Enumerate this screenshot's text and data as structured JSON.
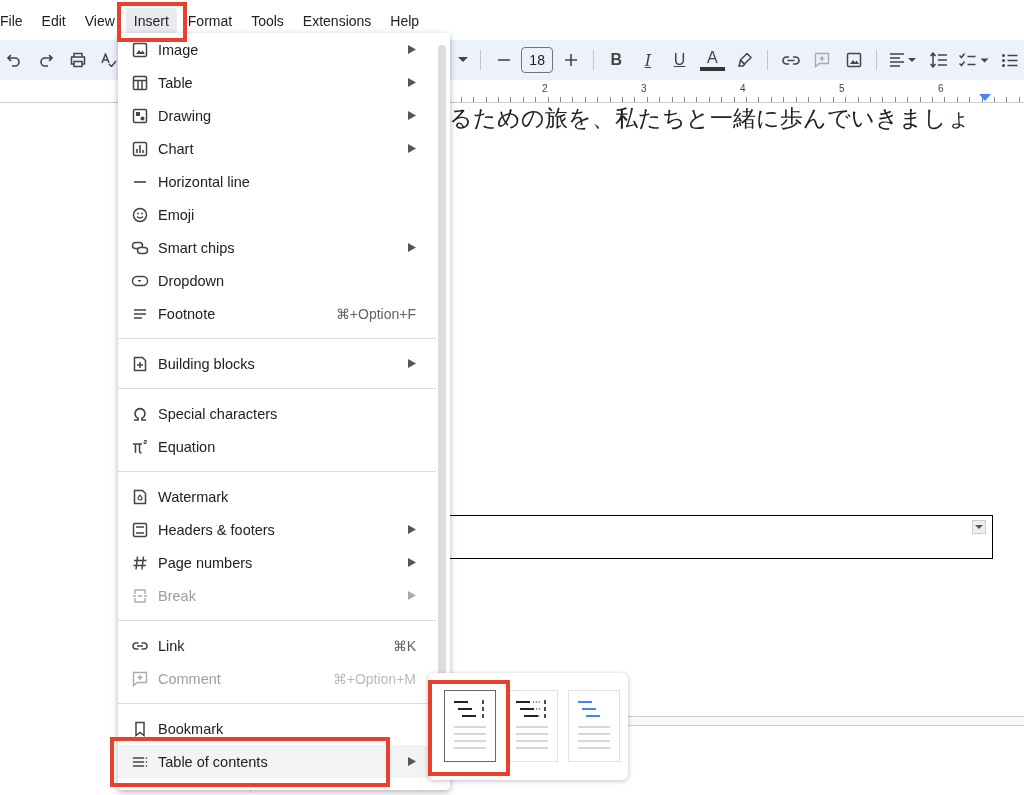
{
  "menu_bar": [
    {
      "label": "File",
      "selected": false,
      "highlighted": false
    },
    {
      "label": "Edit",
      "selected": false,
      "highlighted": false
    },
    {
      "label": "View",
      "selected": false,
      "highlighted": false
    },
    {
      "label": "Insert",
      "selected": true,
      "highlighted": true
    },
    {
      "label": "Format",
      "selected": false,
      "highlighted": false
    },
    {
      "label": "Tools",
      "selected": false,
      "highlighted": false
    },
    {
      "label": "Extensions",
      "selected": false,
      "highlighted": false
    },
    {
      "label": "Help",
      "selected": false,
      "highlighted": false
    }
  ],
  "toolbar": {
    "font_size": "18",
    "format_buttons": [
      "B",
      "I",
      "U",
      "A"
    ]
  },
  "ruler": {
    "numbers": [
      "2",
      "3",
      "4",
      "5",
      "6"
    ]
  },
  "document": {
    "text": "るための旅を、私たちと一緒に歩んでいきましょ"
  },
  "insert_menu": {
    "groups": [
      [
        {
          "label": "Image",
          "submenu": true,
          "disabled": false,
          "selected": false,
          "highlighted": false
        },
        {
          "label": "Table",
          "submenu": true,
          "disabled": false,
          "selected": false,
          "highlighted": false
        },
        {
          "label": "Drawing",
          "submenu": true,
          "disabled": false,
          "selected": false,
          "highlighted": false
        },
        {
          "label": "Chart",
          "submenu": true,
          "disabled": false,
          "selected": false,
          "highlighted": false
        },
        {
          "label": "Horizontal line",
          "submenu": false,
          "disabled": false,
          "selected": false,
          "highlighted": false
        },
        {
          "label": "Emoji",
          "submenu": false,
          "disabled": false,
          "selected": false,
          "highlighted": false
        },
        {
          "label": "Smart chips",
          "submenu": true,
          "disabled": false,
          "selected": false,
          "highlighted": false
        },
        {
          "label": "Dropdown",
          "submenu": false,
          "disabled": false,
          "selected": false,
          "highlighted": false
        },
        {
          "label": "Footnote",
          "shortcut": "⌘+Option+F",
          "submenu": false,
          "disabled": false,
          "selected": false,
          "highlighted": false
        }
      ],
      [
        {
          "label": "Building blocks",
          "submenu": true,
          "disabled": false,
          "selected": false,
          "highlighted": false
        }
      ],
      [
        {
          "label": "Special characters",
          "submenu": false,
          "disabled": false,
          "selected": false,
          "highlighted": false
        },
        {
          "label": "Equation",
          "submenu": false,
          "disabled": false,
          "selected": false,
          "highlighted": false
        }
      ],
      [
        {
          "label": "Watermark",
          "submenu": false,
          "disabled": false,
          "selected": false,
          "highlighted": false
        },
        {
          "label": "Headers & footers",
          "submenu": true,
          "disabled": false,
          "selected": false,
          "highlighted": false
        },
        {
          "label": "Page numbers",
          "submenu": true,
          "disabled": false,
          "selected": false,
          "highlighted": false
        },
        {
          "label": "Break",
          "submenu": true,
          "disabled": true,
          "selected": false,
          "highlighted": false
        }
      ],
      [
        {
          "label": "Link",
          "shortcut": "⌘K",
          "submenu": false,
          "disabled": false,
          "selected": false,
          "highlighted": false
        },
        {
          "label": "Comment",
          "shortcut": "⌘+Option+M",
          "submenu": false,
          "disabled": true,
          "selected": false,
          "highlighted": false
        }
      ],
      [
        {
          "label": "Bookmark",
          "submenu": false,
          "disabled": false,
          "selected": false,
          "highlighted": false
        },
        {
          "label": "Table of contents",
          "submenu": true,
          "disabled": false,
          "selected": true,
          "highlighted": true
        }
      ]
    ]
  },
  "toc_submenu": {
    "styles": [
      {
        "kind": "plain",
        "selected": true,
        "highlighted": true
      },
      {
        "kind": "dotted",
        "selected": false,
        "highlighted": false
      },
      {
        "kind": "links",
        "selected": false,
        "highlighted": false
      }
    ]
  }
}
